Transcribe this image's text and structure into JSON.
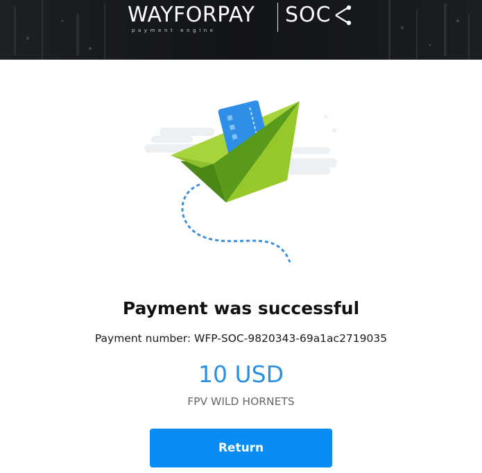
{
  "header": {
    "brand_name": "WAYFORPAY",
    "brand_tagline": "payment engine",
    "partner_name": "SOC",
    "partner_icon": "share-icon"
  },
  "illustration": {
    "icon": "paper-plane-with-card-icon",
    "colors": {
      "plane_light": "#9ccc2c",
      "plane_dark": "#5a9a1a",
      "card": "#2f8fe6",
      "trail": "#3c8fdf",
      "clouds": "#edf0f3"
    }
  },
  "result": {
    "title": "Payment was successful",
    "payment_number": "Payment number: WFP-SOC-9820343-69a1ac2719035",
    "amount": "10 USD",
    "merchant": "FPV WILD HORNETS"
  },
  "actions": {
    "return_label": "Return"
  },
  "colors": {
    "accent": "#0a8cf5",
    "amount_text": "#2b8fe0",
    "header_bg": "#16181c"
  }
}
